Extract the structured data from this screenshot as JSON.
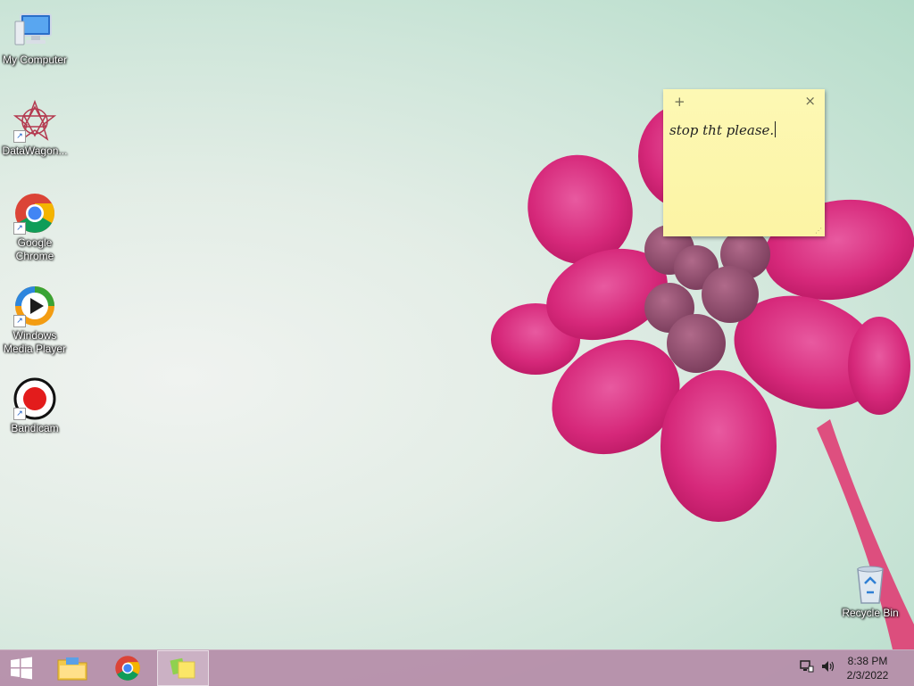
{
  "desktop_icons": [
    {
      "id": "my-computer",
      "label": "My Computer",
      "icon": "computer-icon"
    },
    {
      "id": "datawagon",
      "label": "DataWagon...",
      "icon": "datawagon-icon"
    },
    {
      "id": "google-chrome",
      "label": "Google Chrome",
      "icon": "chrome-icon"
    },
    {
      "id": "windows-media-player",
      "label": "Windows Media Player",
      "icon": "media-player-icon"
    },
    {
      "id": "bandicam",
      "label": "Bandicam",
      "icon": "bandicam-icon"
    },
    {
      "id": "recycle-bin",
      "label": "Recycle Bin",
      "icon": "recycle-bin-icon"
    }
  ],
  "sticky_note": {
    "text": "stop tht please.",
    "add_symbol": "+",
    "close_symbol": "×",
    "colors": {
      "background": "#fcf4a4"
    }
  },
  "taskbar": {
    "start_icon": "windows-logo-icon",
    "pinned": [
      {
        "name": "File Explorer",
        "icon": "folder-icon"
      },
      {
        "name": "Google Chrome",
        "icon": "chrome-icon"
      },
      {
        "name": "Sticky Notes",
        "icon": "sticky-notes-icon",
        "active": true
      }
    ],
    "tray_icons": [
      "network-icon",
      "volume-icon"
    ],
    "clock": {
      "time": "8:38 PM",
      "date": "2/3/2022"
    },
    "colors": {
      "background": "#b58ca8"
    }
  }
}
